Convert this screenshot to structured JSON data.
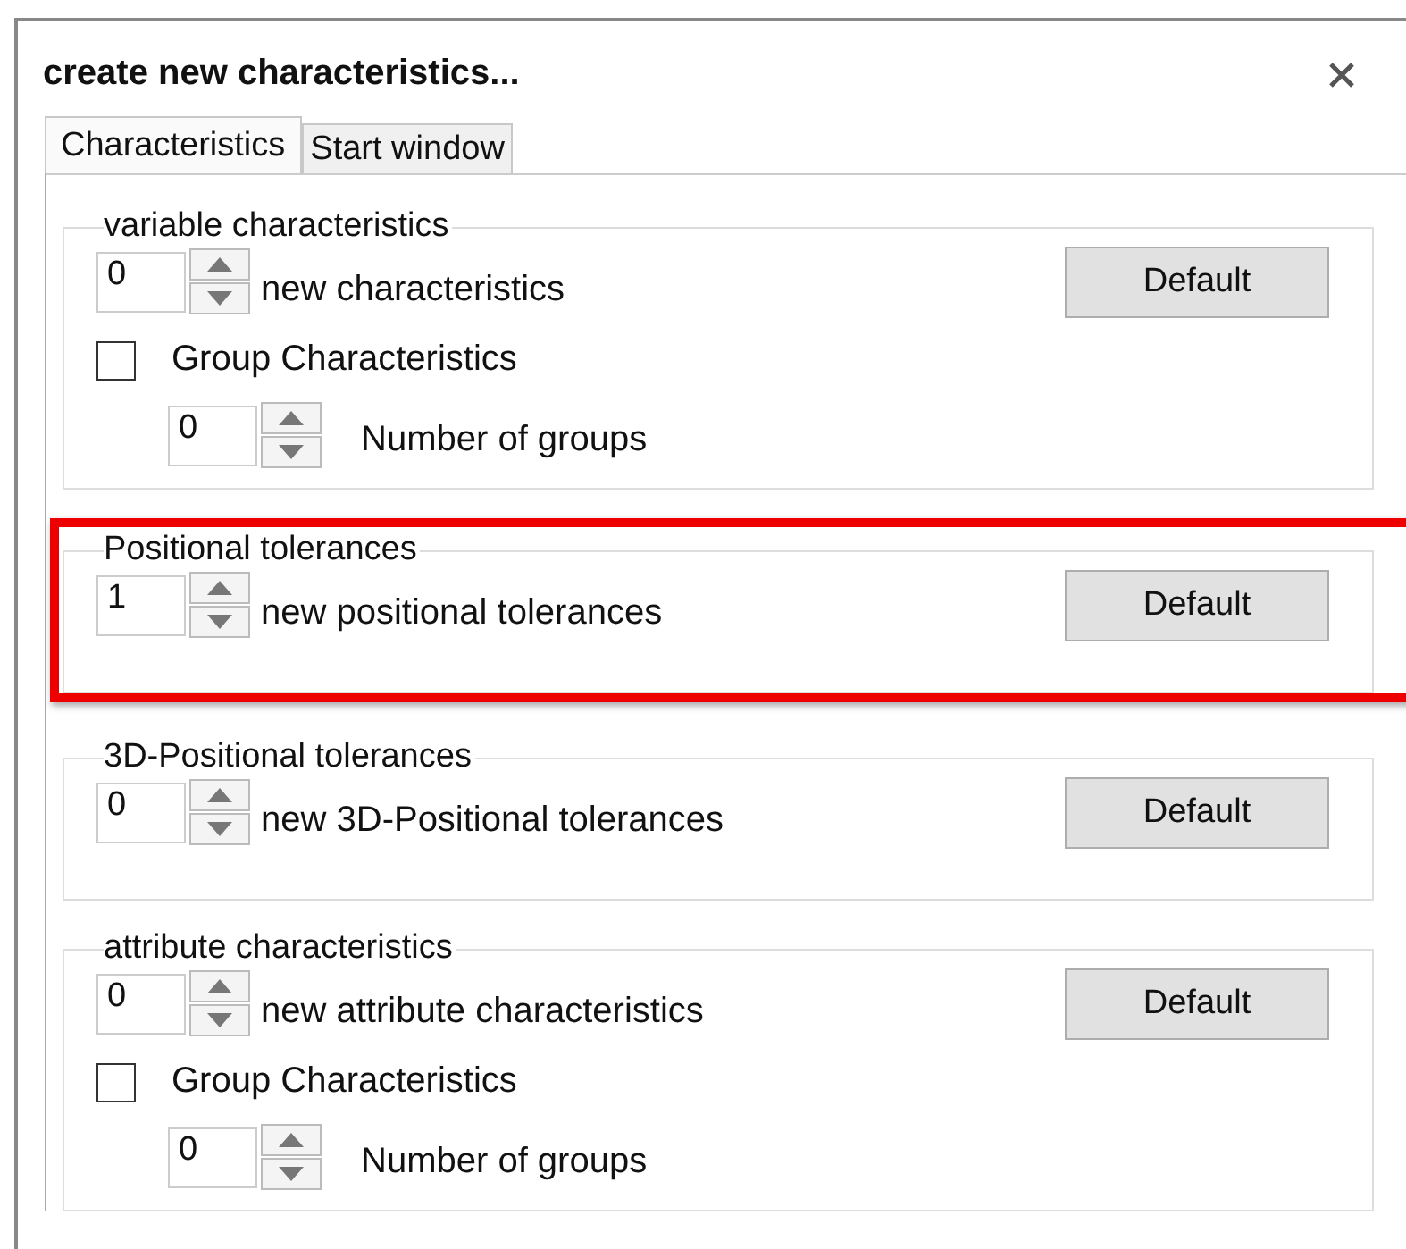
{
  "window": {
    "title": "create new characteristics..."
  },
  "tabs": [
    {
      "label": "Characteristics",
      "selected": true
    },
    {
      "label": "Start window",
      "selected": false
    }
  ],
  "groups": [
    {
      "legend": "variable characteristics",
      "highlighted": false,
      "count": {
        "value": "0",
        "label": "new characteristics"
      },
      "button": "Default",
      "group_option": {
        "label": "Group Characteristics",
        "checked": false,
        "count": {
          "value": "0",
          "label": "Number of groups"
        }
      }
    },
    {
      "legend": "Positional tolerances",
      "highlighted": true,
      "count": {
        "value": "1",
        "label": "new positional tolerances"
      },
      "button": "Default"
    },
    {
      "legend": "3D-Positional tolerances",
      "highlighted": false,
      "count": {
        "value": "0",
        "label": "new 3D-Positional tolerances"
      },
      "button": "Default"
    },
    {
      "legend": "attribute characteristics",
      "highlighted": false,
      "count": {
        "value": "0",
        "label": "new attribute characteristics"
      },
      "button": "Default",
      "group_option": {
        "label": "Group Characteristics",
        "checked": false,
        "count": {
          "value": "0",
          "label": "Number of groups"
        }
      }
    }
  ]
}
